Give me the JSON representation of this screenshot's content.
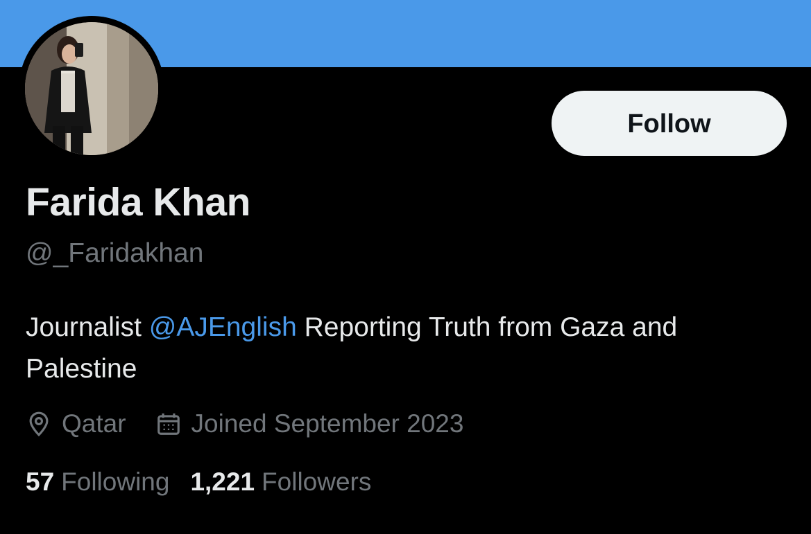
{
  "profile": {
    "display_name": "Farida Khan",
    "handle": "@_Faridakhan",
    "bio": {
      "prefix": "Journalist ",
      "mention": "@AJEnglish",
      "suffix": " Reporting Truth from Gaza and Palestine"
    },
    "location": "Qatar",
    "joined": "Joined September 2023",
    "following_count": "57",
    "following_label": "Following",
    "followers_count": "1,221",
    "followers_label": "Followers"
  },
  "actions": {
    "follow_label": "Follow"
  },
  "icons": {
    "location": "location-pin-icon",
    "joined": "calendar-icon"
  },
  "colors": {
    "banner": "#4a99e9",
    "background": "#000000",
    "accent": "#4a99e9",
    "secondary_text": "#71767b",
    "follow_button_bg": "#eff3f4"
  }
}
